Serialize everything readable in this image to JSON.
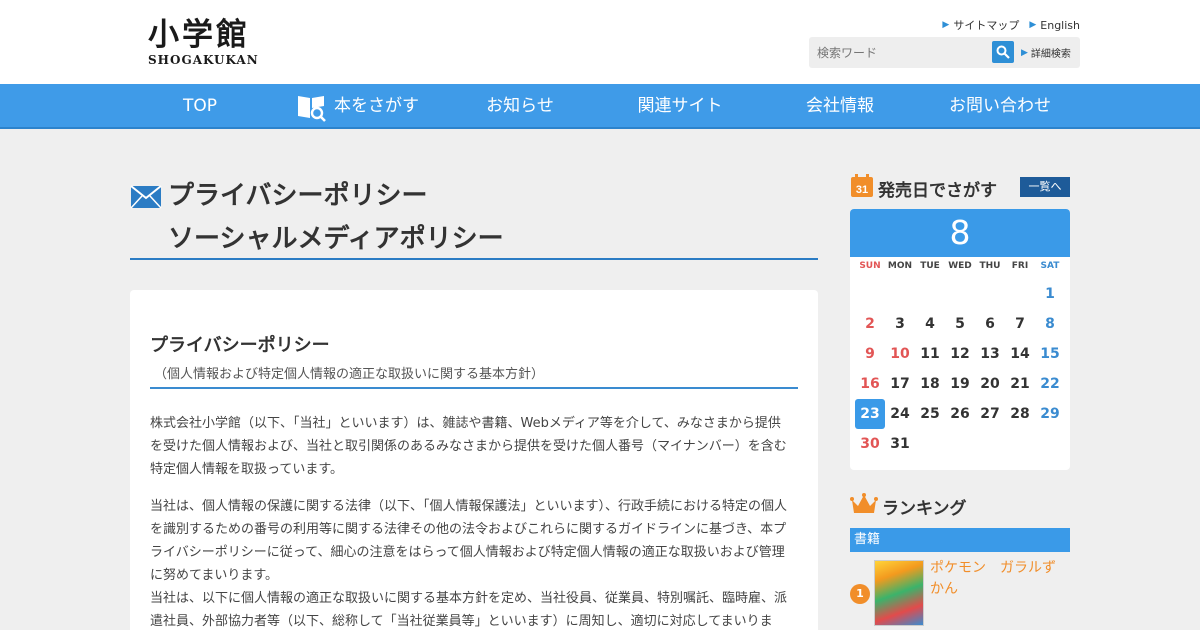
{
  "header": {
    "logo_kanji": "小学館",
    "logo_roman": "SHOGAKUKAN",
    "util_links": [
      "サイトマップ",
      "English"
    ],
    "search_placeholder": "検索ワード",
    "advanced_search": "詳細検索"
  },
  "nav": {
    "items": [
      "TOP",
      "本をさがす",
      "お知らせ",
      "関連サイト",
      "会社情報",
      "お問い合わせ"
    ]
  },
  "page": {
    "title_line1": "プライバシーポリシー",
    "title_line2": "ソーシャルメディアポリシー"
  },
  "article": {
    "heading": "プライバシーポリシー",
    "subheading": "（個人情報および特定個人情報の適正な取扱いに関する基本方針）",
    "paragraphs": [
      "株式会社小学館（以下、「当社」といいます）は、雑誌や書籍、Webメディア等を介して、みなさまから提供を受けた個人情報および、当社と取引関係のあるみなさまから提供を受けた個人番号（マイナンバー）を含む特定個人情報を取扱っています。",
      "当社は、個人情報の保護に関する法律（以下、「個人情報保護法」といいます）、行政手続における特定の個人を識別するための番号の利用等に関する法律その他の法令およびこれらに関するガイドラインに基づき、本プライバシーポリシーに従って、細心の注意をはらって個人情報および特定個人情報の適正な取扱いおよび管理に努めてまいります。",
      "当社は、以下に個人情報の適正な取扱いに関する基本方針を定め、当社役員、従業員、特別嘱託、臨時雇、派遣社員、外部協力者等（以下、総称して「当社従業員等」といいます）に周知し、適切に対応してまいります。"
    ]
  },
  "sidebar": {
    "calendar_heading": "発売日でさがす",
    "calendar_icon_day": "31",
    "list_button": "一覧へ",
    "month": "8",
    "weekdays": [
      "SUN",
      "MON",
      "TUE",
      "WED",
      "THU",
      "FRI",
      "SAT"
    ],
    "days": [
      "1",
      "2",
      "3",
      "4",
      "5",
      "6",
      "7",
      "8",
      "9",
      "10",
      "11",
      "12",
      "13",
      "14",
      "15",
      "16",
      "17",
      "18",
      "19",
      "20",
      "21",
      "22",
      "23",
      "24",
      "25",
      "26",
      "27",
      "28",
      "29",
      "30",
      "31"
    ],
    "today": "23",
    "ranking_heading": "ランキング",
    "ranking_tab": "書籍",
    "ranking_items": [
      {
        "rank": "1",
        "title": "ポケモン　ガラルずかん"
      }
    ]
  },
  "colors": {
    "nav_blue": "#3f9be8",
    "accent_blue": "#2b7cc4",
    "sunday_red": "#e25555",
    "ranking_orange": "#f18e2a",
    "dark_button": "#1e5b99"
  },
  "icons": [
    "search-icon",
    "book-search-icon",
    "mail-icon",
    "calendar-icon",
    "crown-icon",
    "triangle-right-icon"
  ]
}
